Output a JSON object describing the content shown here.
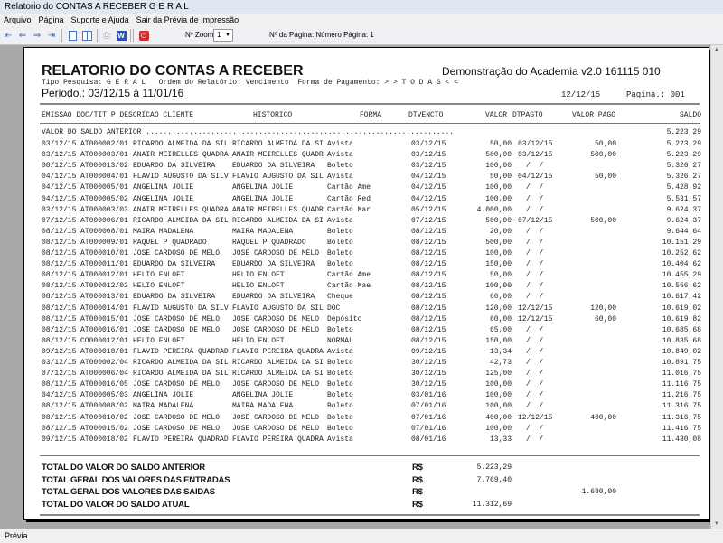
{
  "window": {
    "title": "Relatorio do CONTAS A RECEBER G E R A L"
  },
  "menu": [
    "Arquivo",
    "Página",
    "Suporte e Ajuda",
    "Sair da Prévia de Impressão"
  ],
  "toolbar": {
    "zoom_label": "Nº Zoom",
    "zoom_value": "1",
    "page_label": "Nº da Página: Número Página: 1"
  },
  "report": {
    "title": "RELATORIO DO CONTAS A RECEBER",
    "company": "Demonstração do Academia v2.0 161115 010",
    "filters": "Tipo Pesquisa: G E R A L   Ordem do Relatório: Vencimento  Forma de Pagamento: > > T O D A S < <",
    "period": "Periodo.: 03/12/15 à 11/01/16",
    "date": "12/12/15",
    "page": "Pagina.: 001",
    "headers": {
      "left": "EMISSAO DOC/TIT P DESCRICAO CLIENTE",
      "historico": "HISTORICO",
      "forma": "FORMA",
      "dtvencto": "DTVENCTO",
      "valor": "VALOR",
      "dtpagto": "DTPAGTO",
      "valor_pago": "VALOR PAGO",
      "saldo": "SALDO"
    },
    "saldo_anterior_label": "VALOR DO SALDO ANTERIOR .......................................................................",
    "saldo_anterior_value": "5.223,29",
    "rows": [
      [
        "03/12/15",
        "AT000002/01",
        "RICARDO ALMEIDA DA SIL",
        "RICARDO ALMEIDA DA SI",
        "Avista",
        "03/12/15",
        "50,00",
        "03/12/15",
        "50,00",
        "5.223,29"
      ],
      [
        "03/12/15",
        "AT000003/01",
        "ANAIR MEIRELLES QUADRA",
        "ANAIR MEIRELLES QUADR",
        "Avista",
        "03/12/15",
        "500,00",
        "03/12/15",
        "500,00",
        "5.223,29"
      ],
      [
        "08/12/15",
        "AT000013/02",
        "EDUARDO DA SILVEIRA",
        "EDUARDO DA SILVEIRA",
        "Boleto",
        "03/12/15",
        "100,00",
        "/  /",
        "",
        "5.326,27"
      ],
      [
        "04/12/15",
        "AT000004/01",
        "FLAVIO AUGUSTO DA SILV",
        "FLAVIO AUGUSTO DA SIL",
        "Avista",
        "04/12/15",
        "50,00",
        "04/12/15",
        "50,00",
        "5.326,27"
      ],
      [
        "04/12/15",
        "AT000005/01",
        "ANGELINA JOLIE",
        "ANGELINA JOLIE",
        "Cartão Ame",
        "04/12/15",
        "100,00",
        "/  /",
        "",
        "5.428,92"
      ],
      [
        "04/12/15",
        "AT000005/02",
        "ANGELINA JOLIE",
        "ANGELINA JOLIE",
        "Cartão Red",
        "04/12/15",
        "100,00",
        "/  /",
        "",
        "5.531,57"
      ],
      [
        "03/12/15",
        "AT000003/03",
        "ANAIR MEIRELLES QUADRA",
        "ANAIR MEIRELLES QUADR",
        "Cartão Mar",
        "05/12/15",
        "4.000,00",
        "/  /",
        "",
        "9.624,37"
      ],
      [
        "07/12/15",
        "AT000006/01",
        "RICARDO ALMEIDA DA SIL",
        "RICARDO ALMEIDA DA SI",
        "Avista",
        "07/12/15",
        "500,00",
        "07/12/15",
        "500,00",
        "9.624,37"
      ],
      [
        "08/12/15",
        "AT000008/01",
        "MAIRA MADALENA",
        "MAIRA MADALENA",
        "Boleto",
        "08/12/15",
        "20,00",
        "/  /",
        "",
        "9.644,64"
      ],
      [
        "08/12/15",
        "AT000009/01",
        "RAQUEL P QUADRADO",
        "RAQUEL P QUADRADO",
        "Boleto",
        "08/12/15",
        "500,00",
        "/  /",
        "",
        "10.151,29"
      ],
      [
        "08/12/15",
        "AT000010/01",
        "JOSE CARDOSO DE MELO",
        "JOSE CARDOSO DE MELO",
        "Boleto",
        "08/12/15",
        "100,00",
        "/  /",
        "",
        "10.252,62"
      ],
      [
        "08/12/15",
        "AT000011/01",
        "EDUARDO DA SILVEIRA",
        "EDUARDO DA SILVEIRA",
        "Boleto",
        "08/12/15",
        "150,00",
        "/  /",
        "",
        "10.404,62"
      ],
      [
        "08/12/15",
        "AT000012/01",
        "HELIO ENLOFT",
        "HELIO ENLOFT",
        "Cartão Ame",
        "08/12/15",
        "50,00",
        "/  /",
        "",
        "10.455,29"
      ],
      [
        "08/12/15",
        "AT000012/02",
        "HELIO ENLOFT",
        "HELIO ENLOFT",
        "Cartão Mae",
        "08/12/15",
        "100,00",
        "/  /",
        "",
        "10.556,62"
      ],
      [
        "08/12/15",
        "AT000013/01",
        "EDUARDO DA SILVEIRA",
        "EDUARDO DA SILVEIRA",
        "Cheque",
        "08/12/15",
        "60,00",
        "/  /",
        "",
        "10.617,42"
      ],
      [
        "08/12/15",
        "AT000014/01",
        "FLAVIO AUGUSTO DA SILV",
        "FLAVIO AUGUSTO DA SIL",
        "DOC",
        "08/12/15",
        "120,00",
        "12/12/15",
        "120,00",
        "10.619,02"
      ],
      [
        "08/12/15",
        "AT000015/01",
        "JOSE CARDOSO DE MELO",
        "JOSE CARDOSO DE MELO",
        "Depósito",
        "08/12/15",
        "60,00",
        "12/12/15",
        "60,00",
        "10.619,82"
      ],
      [
        "08/12/15",
        "AT000016/01",
        "JOSE CARDOSO DE MELO",
        "JOSE CARDOSO DE MELO",
        "Boleto",
        "08/12/15",
        "65,00",
        "/  /",
        "",
        "10.685,68"
      ],
      [
        "08/12/15",
        "CO000012/01",
        "HELIO ENLOFT",
        "HELIO ENLOFT",
        "NORMAL",
        "08/12/15",
        "150,00",
        "/  /",
        "",
        "10.835,68"
      ],
      [
        "09/12/15",
        "AT000018/01",
        "FLAVIO PEREIRA QUADRAD",
        "FLAVIO PEREIRA QUADRA",
        "Avista",
        "09/12/15",
        "13,34",
        "/  /",
        "",
        "10.849,02"
      ],
      [
        "03/12/15",
        "AT000002/04",
        "RICARDO ALMEIDA DA SIL",
        "RICARDO ALMEIDA DA SI",
        "Boleto",
        "30/12/15",
        "42,73",
        "/  /",
        "",
        "10.891,75"
      ],
      [
        "07/12/15",
        "AT000006/04",
        "RICARDO ALMEIDA DA SIL",
        "RICARDO ALMEIDA DA SI",
        "Boleto",
        "30/12/15",
        "125,00",
        "/  /",
        "",
        "11.016,75"
      ],
      [
        "08/12/15",
        "AT000016/05",
        "JOSE CARDOSO DE MELO",
        "JOSE CARDOSO DE MELO",
        "Boleto",
        "30/12/15",
        "100,00",
        "/  /",
        "",
        "11.116,75"
      ],
      [
        "04/12/15",
        "AT000005/03",
        "ANGELINA JOLIE",
        "ANGELINA JOLIE",
        "Boleto",
        "03/01/16",
        "100,00",
        "/  /",
        "",
        "11.216,75"
      ],
      [
        "08/12/15",
        "AT000008/02",
        "MAIRA MADALENA",
        "MAIRA MADALENA",
        "Boleto",
        "07/01/16",
        "100,00",
        "/  /",
        "",
        "11.316,75"
      ],
      [
        "08/12/15",
        "AT000010/02",
        "JOSE CARDOSO DE MELO",
        "JOSE CARDOSO DE MELO",
        "Boleto",
        "07/01/16",
        "400,00",
        "12/12/15",
        "400,00",
        "11.316,75"
      ],
      [
        "08/12/15",
        "AT000015/02",
        "JOSE CARDOSO DE MELO",
        "JOSE CARDOSO DE MELO",
        "Boleto",
        "07/01/16",
        "100,00",
        "/  /",
        "",
        "11.416,75"
      ],
      [
        "09/12/15",
        "AT000018/02",
        "FLAVIO PEREIRA QUADRAD",
        "FLAVIO PEREIRA QUADRA",
        "Avista",
        "08/01/16",
        "13,33",
        "/  /",
        "",
        "11.430,08"
      ]
    ],
    "totals": [
      {
        "label": "TOTAL DO VALOR DO SALDO ANTERIOR",
        "currency": "R$",
        "value": "5.223,29",
        "value2": ""
      },
      {
        "label": "TOTAL GERAL DOS VALORES DAS ENTRADAS",
        "currency": "R$",
        "value": "7.769,40",
        "value2": ""
      },
      {
        "label": "TOTAL GERAL DOS VALORES DAS SAIDAS",
        "currency": "R$",
        "value": "",
        "value2": "1.680,00"
      },
      {
        "label": "TOTAL DO VALOR DO SALDO ATUAL",
        "currency": "R$",
        "value": "11.312,69",
        "value2": ""
      }
    ]
  },
  "status": {
    "text": "Prévia"
  }
}
